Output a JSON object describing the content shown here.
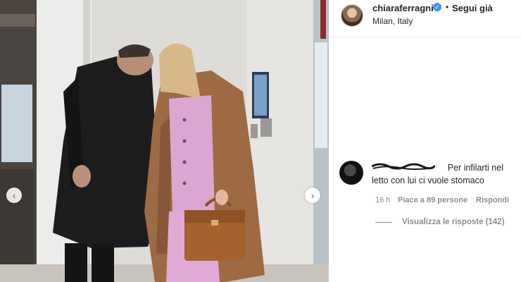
{
  "post": {
    "username": "chiaraferragni",
    "follow_label": "Segui già",
    "location": "Milan, Italy"
  },
  "comment": {
    "text": "Per infilarti nel letto con lui ci vuole stomaco",
    "time": "16 h",
    "likes": "Piace a 89 persone",
    "reply_label": "Rispondi",
    "view_replies_label": "Visualizza le risposte (142)"
  },
  "icons": {
    "verified": "verified-badge-icon",
    "prev": "chevron-left-icon",
    "next": "chevron-right-icon"
  },
  "colors": {
    "verified": "#3897f0",
    "muted": "#8e8e8e",
    "text": "#262626"
  }
}
